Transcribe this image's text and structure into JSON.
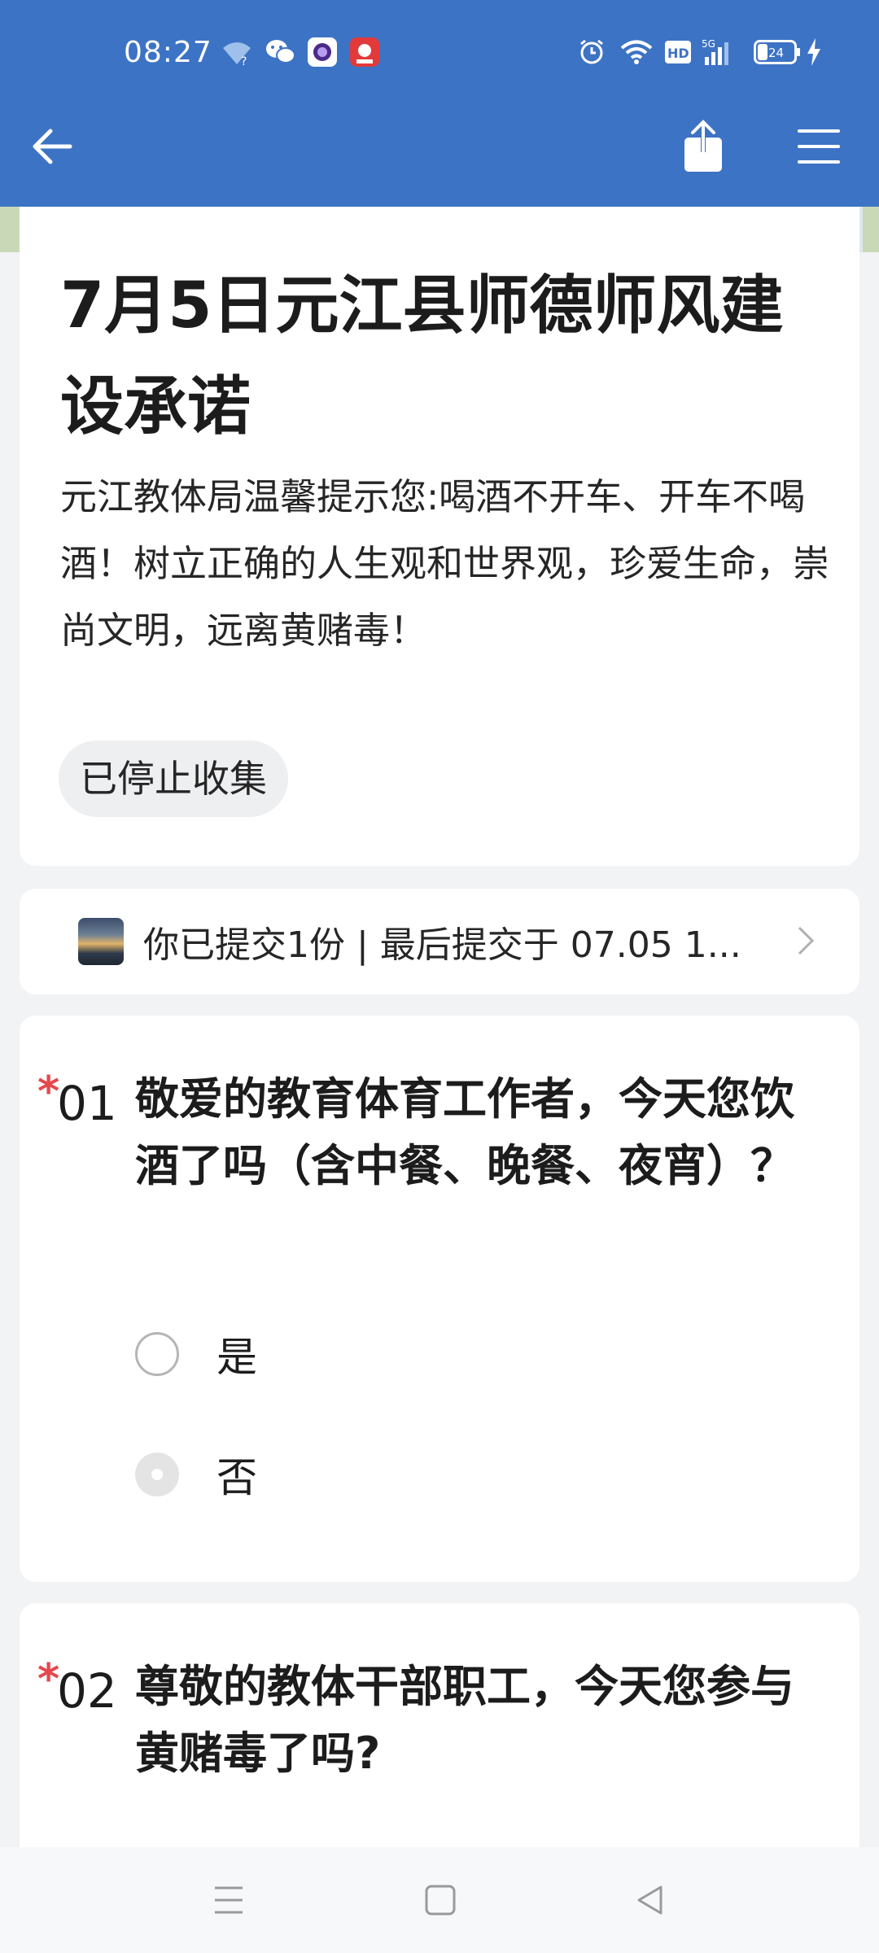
{
  "status_bar": {
    "time": "08:27",
    "battery": "24",
    "network": "5G",
    "hd": "HD"
  },
  "toolbar": {
    "back_icon": "arrow-left-icon",
    "share_icon": "share-icon",
    "menu_icon": "menu-icon"
  },
  "form": {
    "title": "7月5日元江县师德师风建设承诺",
    "description": "元江教体局温馨提示您:喝酒不开车、开车不喝酒！树立正确的人生观和世界观，珍爱生命，崇尚文明，远离黄赌毒！",
    "status_pill": "已停止收集"
  },
  "submission": {
    "text": "你已提交1份 | 最后提交于 07.05 1..."
  },
  "questions": [
    {
      "required": "*",
      "number": "01",
      "text": "敬爱的教育体育工作者，今天您饮酒了吗（含中餐、晚餐、夜宵）？",
      "options": [
        {
          "label": "是",
          "selected": false
        },
        {
          "label": "否",
          "selected": true
        }
      ]
    },
    {
      "required": "*",
      "number": "02",
      "text": "尊敬的教体干部职工，今天您参与黄赌毒了吗?"
    }
  ],
  "colors": {
    "header": "#3d73c4",
    "required": "#e5484d",
    "background": "#f2f3f5"
  }
}
